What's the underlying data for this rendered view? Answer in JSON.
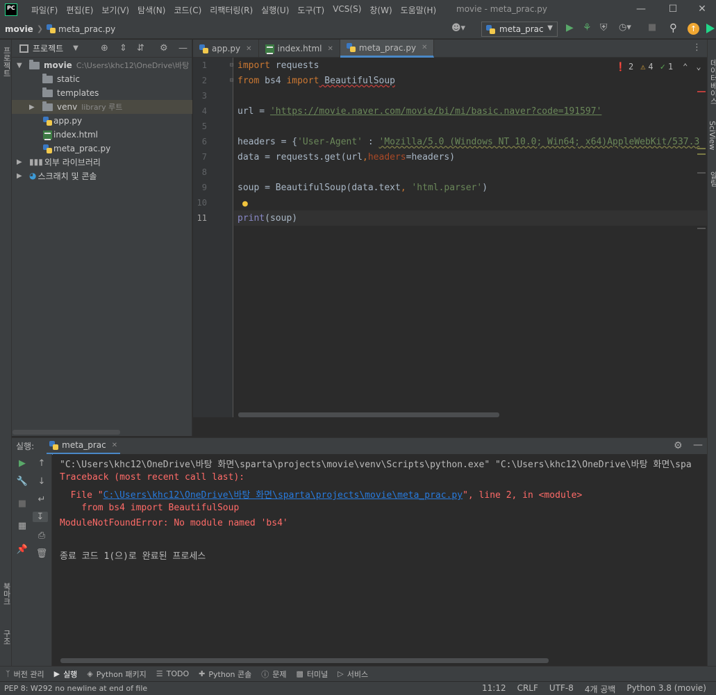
{
  "menubar": {
    "logo": "PC",
    "items": [
      "파일(F)",
      "편집(E)",
      "보기(V)",
      "탐색(N)",
      "코드(C)",
      "리팩터링(R)",
      "실행(U)",
      "도구(T)",
      "VCS(S)",
      "창(W)",
      "도움말(H)"
    ],
    "window_title": "movie - meta_prac.py"
  },
  "navbar": {
    "project": "movie",
    "file": "meta_prac.py",
    "run_config": "meta_prac"
  },
  "left_strip": {
    "project_label": "프로젝트",
    "bookmarks_label": "북마크",
    "structure_label": "구조"
  },
  "right_strip": {
    "database_label": "데이터베이스",
    "sciview_label": "SciView",
    "notifications_label": "알림"
  },
  "project_panel": {
    "title": "프로젝트",
    "tree": {
      "root": "movie",
      "root_path": "C:\\Users\\khc12\\OneDrive\\바탕",
      "static": "static",
      "templates": "templates",
      "venv": "venv",
      "venv_note": "library 루트",
      "app": "app.py",
      "index": "index.html",
      "meta": "meta_prac.py",
      "ext_libs": "외부 라이브러리",
      "scratches": "스크래치 및 콘솔"
    }
  },
  "tabs": [
    {
      "label": "app.py",
      "icon": "python-file-icon"
    },
    {
      "label": "index.html",
      "icon": "html-file-icon"
    },
    {
      "label": "meta_prac.py",
      "icon": "python-file-icon",
      "active": true
    }
  ],
  "inspections": {
    "errors": "2",
    "warnings": "4",
    "typos": "1"
  },
  "code": {
    "line_numbers": [
      "1",
      "2",
      "3",
      "4",
      "5",
      "6",
      "7",
      "8",
      "9",
      "10",
      "11"
    ],
    "l1_kw": "import",
    "l1_rest": " requests",
    "l2_kw1": "from",
    "l2_mod": " bs4 ",
    "l2_kw2": "import",
    "l2_rest": " BeautifulSoup",
    "l4_a": "url = ",
    "l4_url": "'https://movie.naver.com/movie/bi/mi/basic.naver?code=191597'",
    "l6_a": "headers = {",
    "l6_key": "'User-Agent'",
    "l6_b": " : ",
    "l6_val": "'Mozilla/5.0 (Windows NT 10.0; Win64; x64)AppleWebKit/537.3",
    "l7_a": "data = requests.get(url",
    "l7_comma": ",",
    "l7_param": "headers",
    "l7_b": "=headers)",
    "l9_a": "soup = BeautifulSoup(data.text",
    "l9_comma": ", ",
    "l9_str": "'html.parser'",
    "l9_b": ")",
    "l11_fn": "print",
    "l11_b": "(soup)"
  },
  "run_panel": {
    "label": "실행:",
    "tab": "meta_prac",
    "console": {
      "cmd": "\"C:\\Users\\khc12\\OneDrive\\바탕 화면\\sparta\\projects\\movie\\venv\\Scripts\\python.exe\" \"C:\\Users\\khc12\\OneDrive\\바탕 화면\\spa",
      "traceback": "Traceback (most recent call last):",
      "file_prefix": "  File \"",
      "file_link": "C:\\Users\\khc12\\OneDrive\\바탕 화면\\sparta\\projects\\movie\\meta_prac.py",
      "file_suffix": "\", line 2, in <module>",
      "src": "    from bs4 import BeautifulSoup",
      "error": "ModuleNotFoundError: No module named 'bs4'",
      "exit": "종료 코드 1(으)로 완료된 프로세스"
    }
  },
  "bottom_tools": [
    "버전 관리",
    "실행",
    "Python 패키지",
    "TODO",
    "Python 콘솔",
    "문제",
    "터미널",
    "서비스"
  ],
  "status": {
    "message": "PEP 8: W292 no newline at end of file",
    "position": "11:12",
    "line_sep": "CRLF",
    "encoding": "UTF-8",
    "indent": "4개 공백",
    "interpreter": "Python 3.8 (movie)"
  }
}
